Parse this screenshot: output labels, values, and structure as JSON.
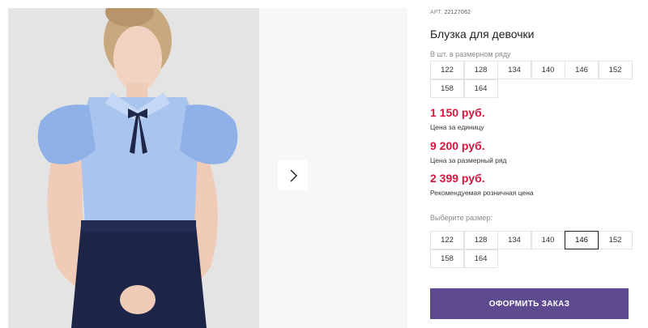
{
  "product": {
    "article_label": "АРТ.",
    "article_number": "22127062",
    "title": "Блузка для девочки"
  },
  "size_series": {
    "caption": "В шт. в размерном ряду",
    "sizes": [
      "122",
      "128",
      "134",
      "140",
      "146",
      "152",
      "158",
      "164"
    ]
  },
  "prices": [
    {
      "value": "1 150 руб.",
      "note": "Цена за единицу"
    },
    {
      "value": "9 200 руб.",
      "note": "Цена за размерный ряд"
    },
    {
      "value": "2 399 руб.",
      "note": "Рекомендуемая розничная цена"
    }
  ],
  "size_picker": {
    "caption": "Выберите размер:",
    "sizes": [
      "122",
      "128",
      "134",
      "140",
      "146",
      "152",
      "158",
      "164"
    ],
    "selected": "146"
  },
  "order_button_label": "ОФОРМИТЬ ЗАКАЗ",
  "gallery": {
    "next_icon": "chevron-right-icon"
  },
  "colors": {
    "accent_price": "#d4173c",
    "order_button": "#5e4a8e"
  }
}
